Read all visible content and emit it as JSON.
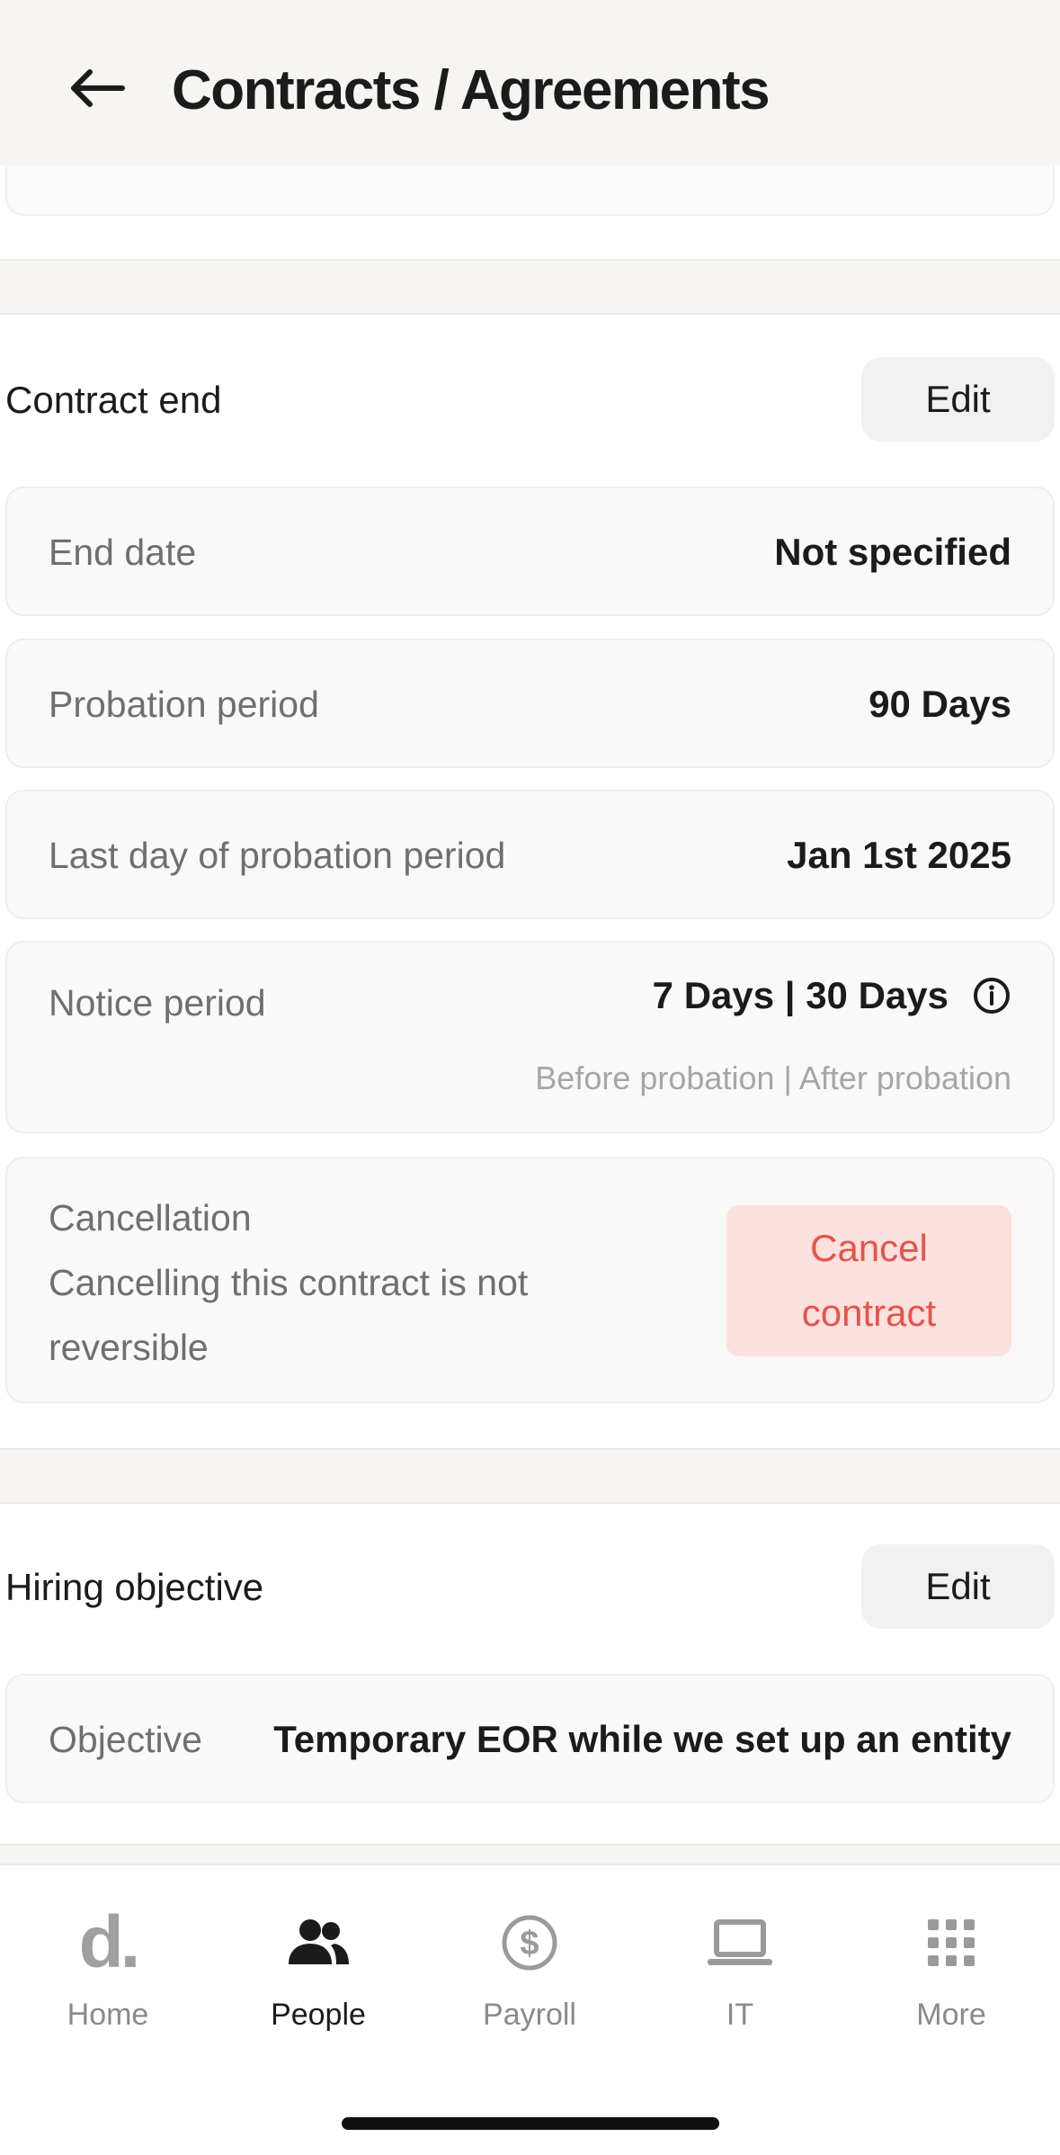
{
  "header": {
    "title": "Contracts / Agreements",
    "back_icon": "arrow-left-icon"
  },
  "contract_end": {
    "title": "Contract end",
    "edit_label": "Edit",
    "end_date": {
      "label": "End date",
      "value": "Not specified"
    },
    "probation": {
      "label": "Probation period",
      "value": "90 Days"
    },
    "last_day_probation": {
      "label": "Last day of probation period",
      "value": "Jan 1st 2025"
    },
    "notice": {
      "label": "Notice period",
      "value": "7 Days | 30 Days",
      "sub": "Before probation | After probation",
      "info_icon": "info-icon"
    },
    "cancellation": {
      "label": "Cancellation",
      "description": "Cancelling this contract is not reversible",
      "button_label": "Cancel contract"
    }
  },
  "hiring_objective": {
    "title": "Hiring objective",
    "edit_label": "Edit",
    "objective": {
      "label": "Objective",
      "value": "Temporary EOR while we set up an entity"
    }
  },
  "bottom_nav": {
    "items": [
      {
        "label": "Home",
        "icon": "deel-logo-icon",
        "logo_text": "d.",
        "active": false
      },
      {
        "label": "People",
        "icon": "people-icon",
        "active": true
      },
      {
        "label": "Payroll",
        "icon": "dollar-circle-icon",
        "active": false
      },
      {
        "label": "IT",
        "icon": "laptop-icon",
        "active": false
      },
      {
        "label": "More",
        "icon": "grid-icon",
        "active": false
      }
    ]
  },
  "colors": {
    "header_bg": "#f6f5f2",
    "danger_text": "#e5534b",
    "danger_bg": "#fde1de"
  }
}
